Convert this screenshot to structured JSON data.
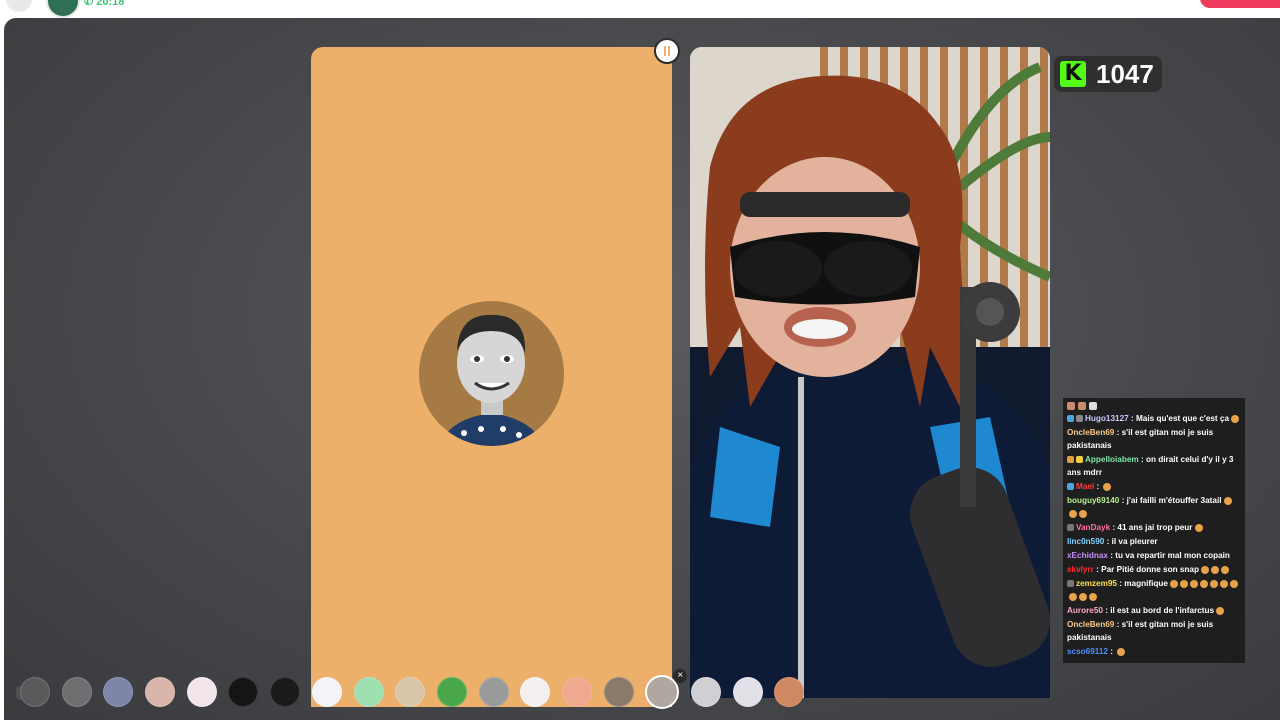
{
  "top_bar": {
    "timer": "20:18"
  },
  "kick": {
    "viewer_count": "1047",
    "logo_letter": "K",
    "brand_color": "#53fc18"
  },
  "chat": {
    "messages": [
      {
        "user": "Hugo13127",
        "user_color": "#c9c9ff",
        "text": " : Mais qu'est que c'est ça",
        "badges": [
          "#4fa3e0",
          "#888888"
        ],
        "emojis": 1
      },
      {
        "user": "OncleBen69",
        "user_color": "#f5c98a",
        "text": " : s'il est gitan moi je suis pakistanais",
        "badges": [],
        "emojis": 0
      },
      {
        "user": "Appelloiabem",
        "user_color": "#7ee8a8",
        "text": " : on dirait celui d'y il y 3 ans mdrr",
        "badges": [
          "#e0a040",
          "#f0d040"
        ],
        "emojis": 0
      },
      {
        "user": "Mael",
        "user_color": "#ff3b3b",
        "text": " : ",
        "badges": [
          "#4fa3e0"
        ],
        "emojis": 1
      },
      {
        "user": "bouguy69140",
        "user_color": "#b8f08c",
        "text": " : j'ai failli m'étouffer 3atail",
        "badges": [],
        "emojis": 3
      },
      {
        "user": "VanDayk",
        "user_color": "#ff6ea8",
        "text": " : 41 ans jai trop peur",
        "badges": [
          "#777777"
        ],
        "emojis": 1
      },
      {
        "user": "linc0n590",
        "user_color": "#7ed3ff",
        "text": " : il va pleurer",
        "badges": [],
        "emojis": 0
      },
      {
        "user": "xEchidnax",
        "user_color": "#c48cff",
        "text": " : tu va repartir mal mon copain",
        "badges": [],
        "emojis": 0
      },
      {
        "user": "skvlyrr",
        "user_color": "#ff2a2a",
        "text": " : Par Pitié donne son snap",
        "badges": [],
        "emojis": 3
      },
      {
        "user": "zemzem95",
        "user_color": "#ffe04a",
        "text": " : magnifique",
        "badges": [
          "#777777"
        ],
        "emojis": 10
      },
      {
        "user": "Aurore50",
        "user_color": "#ffa6c9",
        "text": " : il est au bord de l'infarctus",
        "badges": [],
        "emojis": 1
      },
      {
        "user": "OncleBen69",
        "user_color": "#f5c98a",
        "text": " : s'il est gitan moi je suis pakistanais",
        "badges": [],
        "emojis": 0
      },
      {
        "user": "scso69112",
        "user_color": "#4f8cff",
        "text": " : ",
        "badges": [],
        "emojis": 1
      }
    ]
  },
  "reactions": [
    {
      "name": "reaction-dark-face",
      "color": "#5a5a5c"
    },
    {
      "name": "reaction-gray-face",
      "color": "#6e6e70"
    },
    {
      "name": "reaction-blue-face",
      "color": "#7d86a8"
    },
    {
      "name": "reaction-pink-blush",
      "color": "#d9b4aa"
    },
    {
      "name": "reaction-white-cat",
      "color": "#f2e6ea"
    },
    {
      "name": "reaction-black-devil",
      "color": "#151515"
    },
    {
      "name": "reaction-plus-05",
      "color": "#1a1a1a"
    },
    {
      "name": "reaction-stars",
      "color": "#f4f4f8"
    },
    {
      "name": "reaction-green-face",
      "color": "#9fe0b0"
    },
    {
      "name": "reaction-bearded-face",
      "color": "#d9c6aa"
    },
    {
      "name": "reaction-green-alien",
      "color": "#4aa84a"
    },
    {
      "name": "reaction-sunglasses",
      "color": "#9a9a9a"
    },
    {
      "name": "reaction-white-face",
      "color": "#f4f0f2"
    },
    {
      "name": "reaction-peach-face",
      "color": "#f0a890"
    },
    {
      "name": "reaction-donkey",
      "color": "#8a7a6a"
    },
    {
      "name": "reaction-hairy-face",
      "color": "#b0a8a0",
      "selected": true
    },
    {
      "name": "reaction-sad-face",
      "color": "#d0d0d4"
    },
    {
      "name": "reaction-pale-face",
      "color": "#e0e0e6"
    },
    {
      "name": "reaction-tan-face",
      "color": "#d08860"
    }
  ],
  "colors": {
    "left_panel": "#ecb06b",
    "stage_bg": "#4a4b4e",
    "accent_red": "#ef3b5d",
    "accent_green": "#3cc476"
  }
}
